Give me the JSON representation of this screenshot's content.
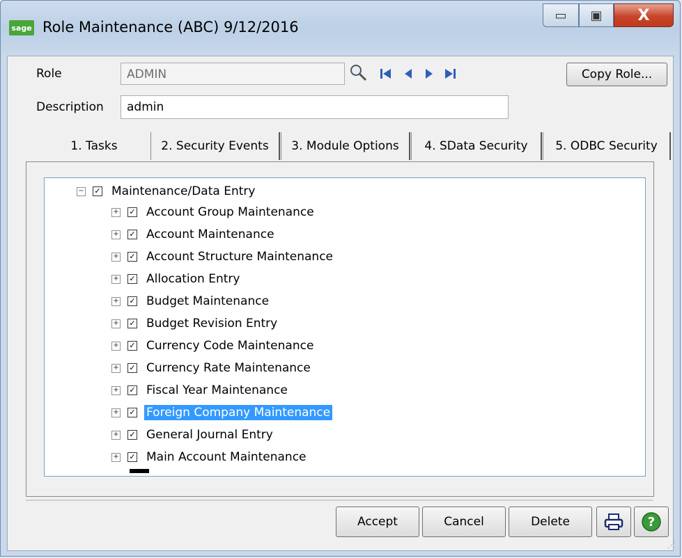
{
  "window": {
    "title": "Role Maintenance (ABC) 9/12/2016",
    "app_icon_text": "sage",
    "min_glyph": "▭",
    "max_glyph": "▣",
    "close_glyph": "X"
  },
  "form": {
    "role_label": "Role",
    "role_value": "ADMIN",
    "description_label": "Description",
    "description_value": "admin",
    "copy_role_label": "Copy Role..."
  },
  "nav_icons": [
    "search-icon",
    "first-record-icon",
    "previous-record-icon",
    "next-record-icon",
    "last-record-icon"
  ],
  "tabs": [
    {
      "label": "1. Tasks",
      "active": true
    },
    {
      "label": "2. Security Events",
      "active": false
    },
    {
      "label": "3. Module Options",
      "active": false
    },
    {
      "label": "4. SData Security",
      "active": false
    },
    {
      "label": "5. ODBC Security",
      "active": false
    }
  ],
  "tree": {
    "parent": {
      "label": "Maintenance/Data Entry",
      "checked": true,
      "expanded": true
    },
    "items": [
      {
        "label": "Account Group Maintenance",
        "checked": true
      },
      {
        "label": "Account Maintenance",
        "checked": true
      },
      {
        "label": "Account Structure Maintenance",
        "checked": true
      },
      {
        "label": "Allocation Entry",
        "checked": true
      },
      {
        "label": "Budget Maintenance",
        "checked": true
      },
      {
        "label": "Budget Revision Entry",
        "checked": true
      },
      {
        "label": "Currency Code Maintenance",
        "checked": true
      },
      {
        "label": "Currency Rate Maintenance",
        "checked": true
      },
      {
        "label": "Fiscal Year Maintenance",
        "checked": true
      },
      {
        "label": "Foreign Company Maintenance",
        "checked": true,
        "selected": true
      },
      {
        "label": "General Journal Entry",
        "checked": true
      },
      {
        "label": "Main Account Maintenance",
        "checked": true
      }
    ]
  },
  "buttons": {
    "accept": "Accept",
    "cancel": "Cancel",
    "delete": "Delete"
  },
  "colors": {
    "selection": "#3399ff",
    "nav_icon": "#2e5fb8",
    "help": "#3b9a3b"
  }
}
